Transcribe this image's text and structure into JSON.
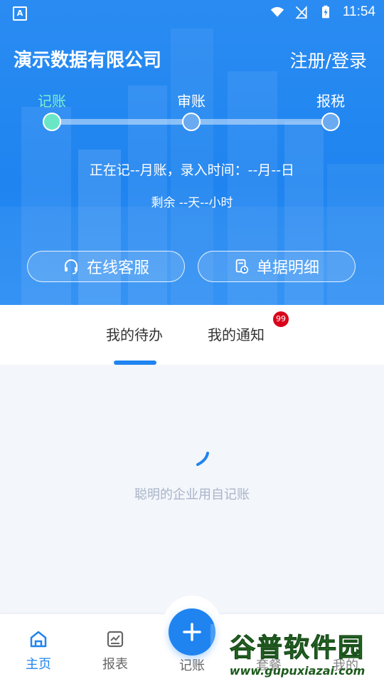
{
  "status_bar": {
    "time": "11:54"
  },
  "header": {
    "company_name": "演示数据有限公司",
    "login_link": "注册/登录"
  },
  "progress_steps": [
    {
      "label": "记账",
      "active": true
    },
    {
      "label": "审账",
      "active": false
    },
    {
      "label": "报税",
      "active": false
    }
  ],
  "status_info": {
    "line1": "正在记--月账，录入时间：--月--日",
    "line2": "剩余 --天--小时"
  },
  "actions": {
    "online_service": "在线客服",
    "documents": "单据明细"
  },
  "tabs": [
    {
      "label": "我的待办",
      "active": true
    },
    {
      "label": "我的通知",
      "active": false,
      "badge": "99"
    }
  ],
  "empty_state": {
    "slogan": "聪明的企业用自记账"
  },
  "bottom_nav": [
    {
      "label": "主页",
      "icon": "home-icon",
      "active": true
    },
    {
      "label": "报表",
      "icon": "report-icon",
      "active": false
    },
    {
      "label": "记账",
      "icon": "plus-icon",
      "active": false
    },
    {
      "label": "套餐",
      "icon": "package-icon",
      "active": false
    },
    {
      "label": "我的",
      "icon": "profile-icon",
      "active": false
    }
  ],
  "watermark": {
    "main": "谷普软件园",
    "sub": "www.gupuxiazai.com"
  },
  "colors": {
    "primary": "#1f84f0",
    "active_step": "#6ae6c6",
    "badge": "#d9001b"
  }
}
